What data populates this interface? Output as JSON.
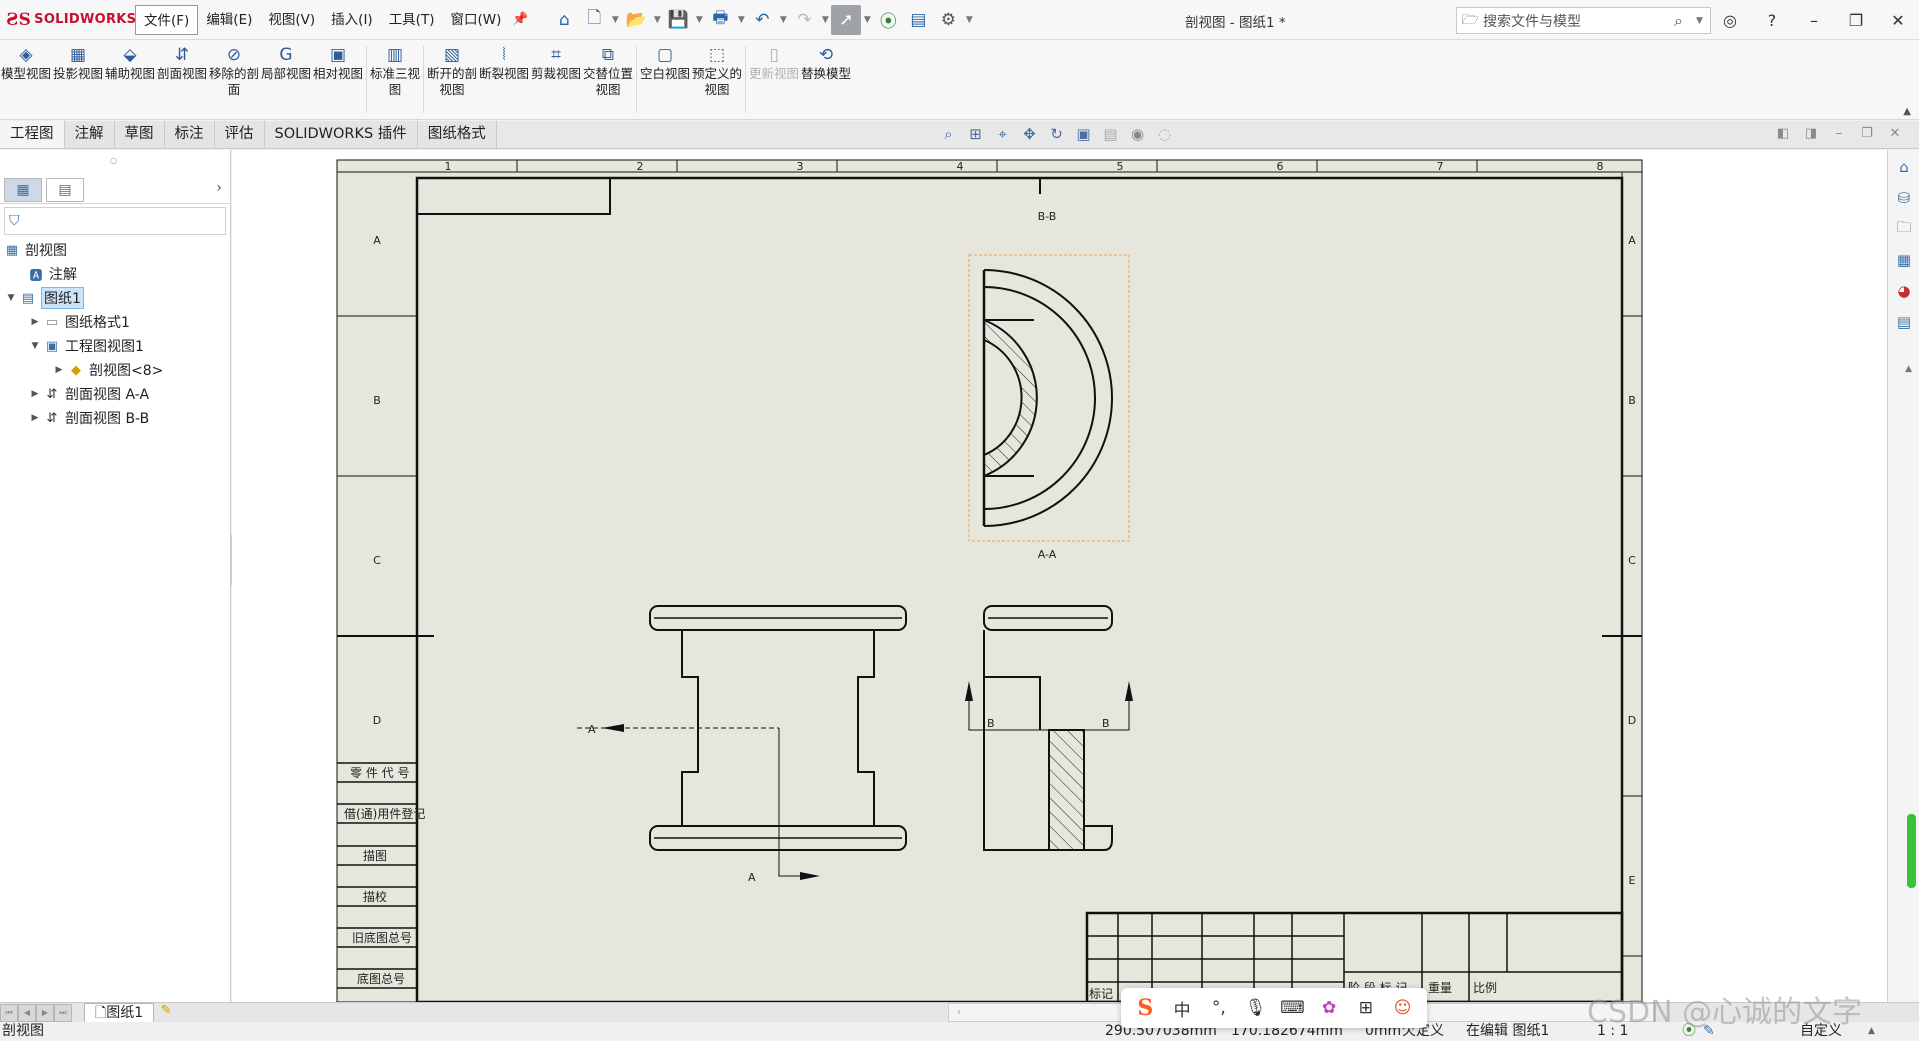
{
  "app": {
    "logo": "SOLIDWORKS",
    "document_title": "剖视图 - 图纸1 *",
    "search_placeholder": "搜索文件与模型"
  },
  "menus": [
    "文件(F)",
    "编辑(E)",
    "视图(V)",
    "插入(I)",
    "工具(T)",
    "窗口(W)"
  ],
  "quick_icons": [
    "home-icon",
    "new-document-icon",
    "open-icon",
    "save-icon",
    "print-icon",
    "undo-icon",
    "redo-icon",
    "select-pointer-icon",
    "traffic-light-icon",
    "file-properties-icon",
    "options-gear-icon"
  ],
  "ribbon": [
    {
      "label": "模型视图",
      "icon": "model-view-icon"
    },
    {
      "label": "投影视图",
      "icon": "projected-view-icon"
    },
    {
      "label": "辅助视图",
      "icon": "auxiliary-view-icon"
    },
    {
      "label": "剖面视图",
      "icon": "section-view-icon"
    },
    {
      "label": "移除的剖面",
      "icon": "removed-section-icon"
    },
    {
      "label": "局部视图",
      "icon": "detail-view-icon"
    },
    {
      "label": "相对视图",
      "icon": "relative-view-icon"
    },
    {
      "label": "标准三视图",
      "icon": "standard-3-view-icon"
    },
    {
      "label": "断开的剖视图",
      "icon": "broken-out-section-icon"
    },
    {
      "label": "断裂视图",
      "icon": "break-view-icon"
    },
    {
      "label": "剪裁视图",
      "icon": "crop-view-icon"
    },
    {
      "label": "交替位置视图",
      "icon": "alternate-position-icon"
    },
    {
      "label": "空白视图",
      "icon": "empty-view-icon"
    },
    {
      "label": "预定义的视图",
      "icon": "predefined-view-icon"
    },
    {
      "label": "更新视图",
      "icon": "update-view-icon",
      "disabled": true
    },
    {
      "label": "替换模型",
      "icon": "replace-model-icon"
    }
  ],
  "command_tabs": [
    "工程图",
    "注解",
    "草图",
    "标注",
    "评估",
    "SOLIDWORKS 插件",
    "图纸格式"
  ],
  "tree": {
    "root": "剖视图",
    "annotations": "注解",
    "sheet": "图纸1",
    "sheet_format": "图纸格式1",
    "drawing_view": "工程图视图1",
    "part": "剖视图<8>",
    "section_aa": "剖面视图 A-A",
    "section_bb": "剖面视图 B-B"
  },
  "drawing": {
    "col_labels": [
      "1",
      "2",
      "3",
      "4",
      "5",
      "6",
      "7",
      "8"
    ],
    "row_labels": [
      "A",
      "B",
      "C",
      "D",
      "E"
    ],
    "view_label_bb": "B-B",
    "view_label_aa": "A-A",
    "cut_a": "A",
    "cut_a_bottom": "A",
    "cut_b_left": "B",
    "cut_b_right": "B",
    "side_labels": [
      "零 件 代 号",
      "借(通)用件登记",
      "描图",
      "描校",
      "旧底图总号",
      "底图总号"
    ],
    "title_cells": [
      "标记",
      "阶 段 标 记",
      "重量",
      "比例"
    ]
  },
  "sheet_tab": "图纸1",
  "status": {
    "mode": "剖视图",
    "x": "290.507038mm",
    "y": "170.182674mm",
    "z": "0mm",
    "defined": "欠定义",
    "editing": "在编辑 图纸1",
    "scale": "1 : 1",
    "custom": "自定义"
  },
  "ime": {
    "lang": "中"
  },
  "watermark": "CSDN @心诚的文字",
  "colors": {
    "sheet_bg": "#e6e6dc",
    "hatch_frame": "#f0a050",
    "accent": "#c8102e"
  }
}
